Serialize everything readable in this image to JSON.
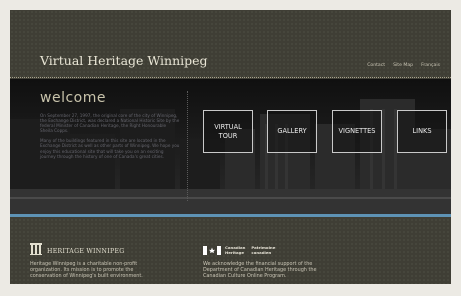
{
  "header": {
    "site_title": "Virtual Heritage Winnipeg",
    "nav": [
      "Contact",
      "Site Map",
      "Français"
    ]
  },
  "hero": {
    "heading": "welcome",
    "paragraph1": "On September 27, 1997, the original core of the city of Winnipeg, the Exchange District, was declared a National Historic Site by the federal Minister of Canadian Heritage, the Right Honourable Sheila Copps.",
    "paragraph2": "Many of the buildings featured in this site are located in the Exchange District as well as other parts of Winnipeg. We hope you enjoy this educational site that will take you on an exciting journey through the history of one of Canada's great cities.",
    "buttons": [
      "VIRTUAL\nTOUR",
      "GALLERY",
      "VIGNETTES",
      "LINKS"
    ]
  },
  "footer": {
    "hw_name": "HERITAGE WINNIPEG",
    "hw_desc": "Heritage Winnipeg is a charitable non-profit organization. Its mission is to promote the conservation of Winnipeg's built environment.",
    "ch_en_1": "Canadian",
    "ch_en_2": "Heritage",
    "ch_fr_1": "Patrimoine",
    "ch_fr_2": "canadien",
    "ch_ack": "We acknowledge the financial support of the Department of Canadian Heritage through the Canadian Culture Online Program."
  },
  "colors": {
    "frame_bg": "#3f3e35",
    "hero_bg": "#141414",
    "accent_line": "#5e93b5",
    "flag_red": "#d52b1e"
  },
  "icons": [
    "heritage-building-icon",
    "canada-flag-icon"
  ]
}
